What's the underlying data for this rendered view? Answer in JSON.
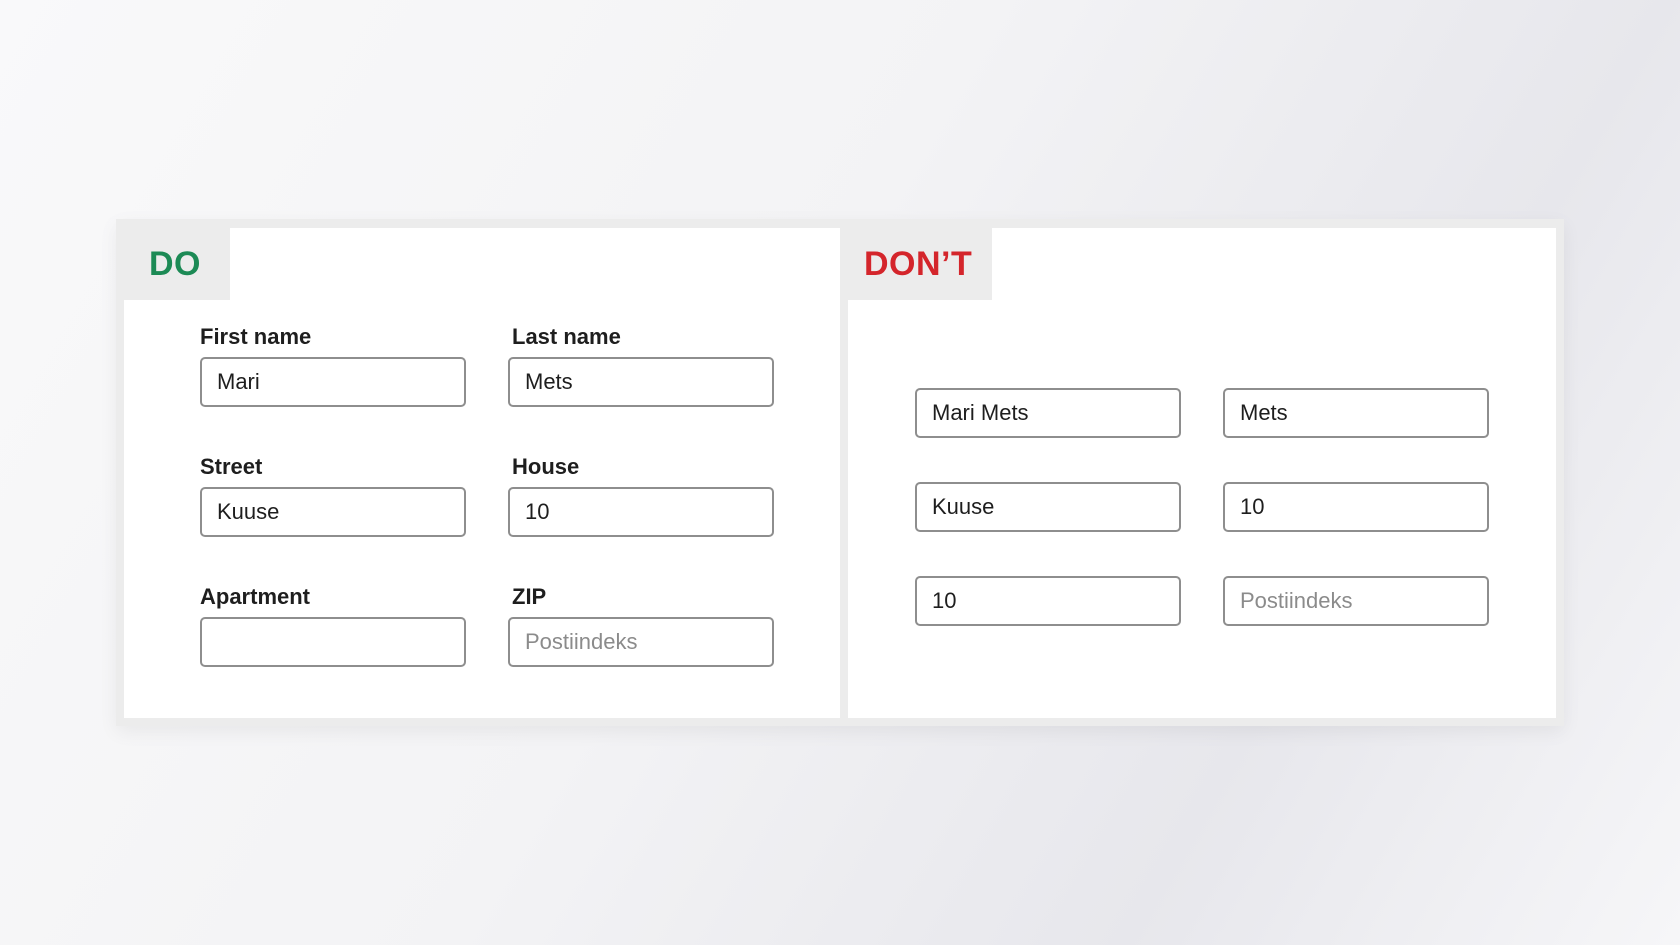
{
  "do_panel": {
    "badge": "DO",
    "fields": {
      "first_name": {
        "label": "First name",
        "value": "Mari",
        "placeholder": ""
      },
      "last_name": {
        "label": "Last name",
        "value": "Mets",
        "placeholder": ""
      },
      "street": {
        "label": "Street",
        "value": "Kuuse",
        "placeholder": ""
      },
      "house": {
        "label": "House",
        "value": "10",
        "placeholder": ""
      },
      "apartment": {
        "label": "Apartment",
        "value": "",
        "placeholder": ""
      },
      "zip": {
        "label": "ZIP",
        "value": "",
        "placeholder": "Postiindeks"
      }
    }
  },
  "dont_panel": {
    "badge": "DON’T",
    "fields": {
      "full_name": {
        "value": "Mari Mets",
        "placeholder": ""
      },
      "last_name": {
        "value": "Mets",
        "placeholder": ""
      },
      "street": {
        "value": "Kuuse",
        "placeholder": ""
      },
      "house": {
        "value": "10",
        "placeholder": ""
      },
      "apartment": {
        "value": "10",
        "placeholder": ""
      },
      "zip": {
        "value": "",
        "placeholder": "Postiindeks"
      }
    }
  },
  "colors": {
    "do_accent": "#1c8a55",
    "dont_accent": "#d4252b",
    "field_border": "#8e8e8e",
    "badge_background": "#ececec"
  }
}
